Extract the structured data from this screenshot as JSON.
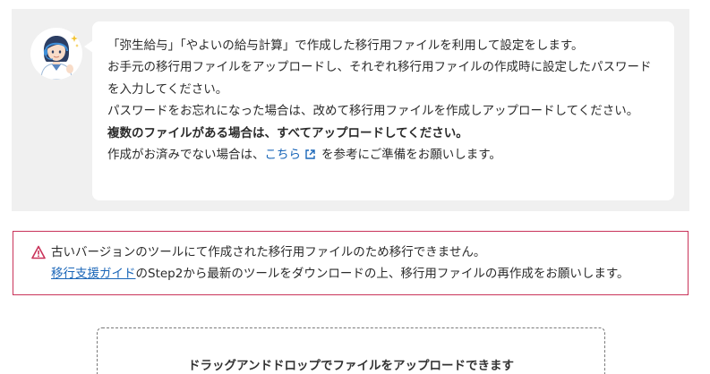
{
  "guide": {
    "line1": "「弥生給与」「やよいの給与計算」で作成した移行用ファイルを利用して設定をします。",
    "line2": "お手元の移行用ファイルをアップロードし、それぞれ移行用ファイルの作成時に設定したパスワードを入力してください。",
    "line3": "パスワードをお忘れになった場合は、改めて移行用ファイルを作成しアップロードしてください。",
    "line4": "複数のファイルがある場合は、すべてアップロードしてください。",
    "line5_prefix": "作成がお済みでない場合は、",
    "line5_link": "こちら",
    "line5_suffix": "を参考にご準備をお願いします。"
  },
  "alert": {
    "message": "古いバージョンのツールにて作成された移行用ファイルのため移行できません。",
    "link_text": "移行支援ガイド",
    "message2": "のStep2から最新のツールをダウンロードの上、移行用ファイルの再作成をお願いします。",
    "color": "#c9335a"
  },
  "dropzone": {
    "label": "ドラッグアンドドロップでファイルをアップロードできます"
  },
  "colors": {
    "link": "#1a66b8",
    "panel_bg": "#f0f0f0"
  }
}
